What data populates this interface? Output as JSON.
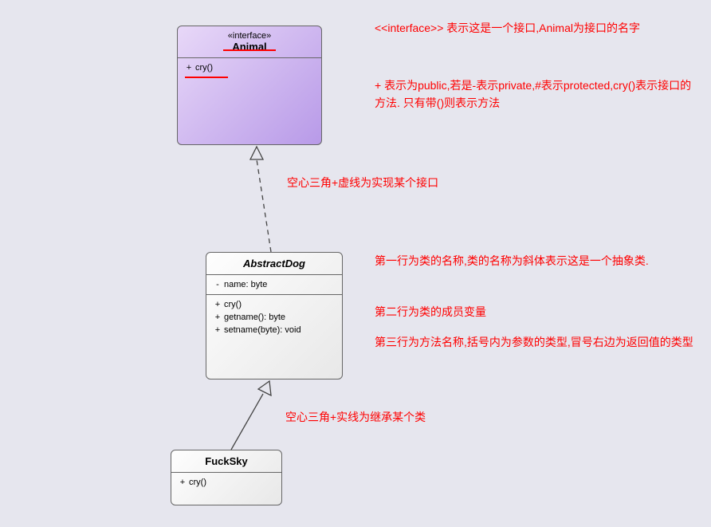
{
  "interface": {
    "stereotype": "«interface»",
    "name": "Animal",
    "methods": [
      {
        "vis": "+",
        "sig": "cry()"
      }
    ]
  },
  "abstract_class": {
    "name": "AbstractDog",
    "attributes": [
      {
        "vis": "-",
        "sig": "name: byte"
      }
    ],
    "methods": [
      {
        "vis": "+",
        "sig": "cry()"
      },
      {
        "vis": "+",
        "sig": "getname(): byte"
      },
      {
        "vis": "+",
        "sig": "setname(byte): void"
      }
    ]
  },
  "concrete_class": {
    "name": "FuckSky",
    "methods": [
      {
        "vis": "+",
        "sig": "cry()"
      }
    ]
  },
  "annotations": {
    "a1": "<<interface>> 表示这是一个接口,Animal为接口的名字",
    "a2": "+ 表示为public,若是-表示private,#表示protected,cry()表示接口的方法.  只有带()则表示方法",
    "a3": "空心三角+虚线为实现某个接口",
    "a4a": "第一行为类的名称,类的名称为斜体表示这是一个抽象类.",
    "a4b": "第二行为类的成员变量",
    "a4c": "第三行为方法名称,括号内为参数的类型,冒号右边为返回值的类型",
    "a5": "空心三角+实线为继承某个类"
  },
  "colors": {
    "annotation": "#ff0000",
    "box_border": "#666666",
    "bg": "#e6e6ee"
  },
  "chart_data": {
    "type": "diagram",
    "kind": "UML class diagram",
    "nodes": [
      {
        "id": "Animal",
        "type": "interface",
        "methods": [
          "+ cry()"
        ]
      },
      {
        "id": "AbstractDog",
        "type": "abstract_class",
        "attributes": [
          "- name: byte"
        ],
        "methods": [
          "+ cry()",
          "+ getname(): byte",
          "+ setname(byte): void"
        ]
      },
      {
        "id": "FuckSky",
        "type": "class",
        "methods": [
          "+ cry()"
        ]
      }
    ],
    "edges": [
      {
        "from": "AbstractDog",
        "to": "Animal",
        "relation": "realization",
        "line": "dashed",
        "arrowhead": "hollow-triangle"
      },
      {
        "from": "FuckSky",
        "to": "AbstractDog",
        "relation": "generalization",
        "line": "solid",
        "arrowhead": "hollow-triangle"
      }
    ]
  }
}
